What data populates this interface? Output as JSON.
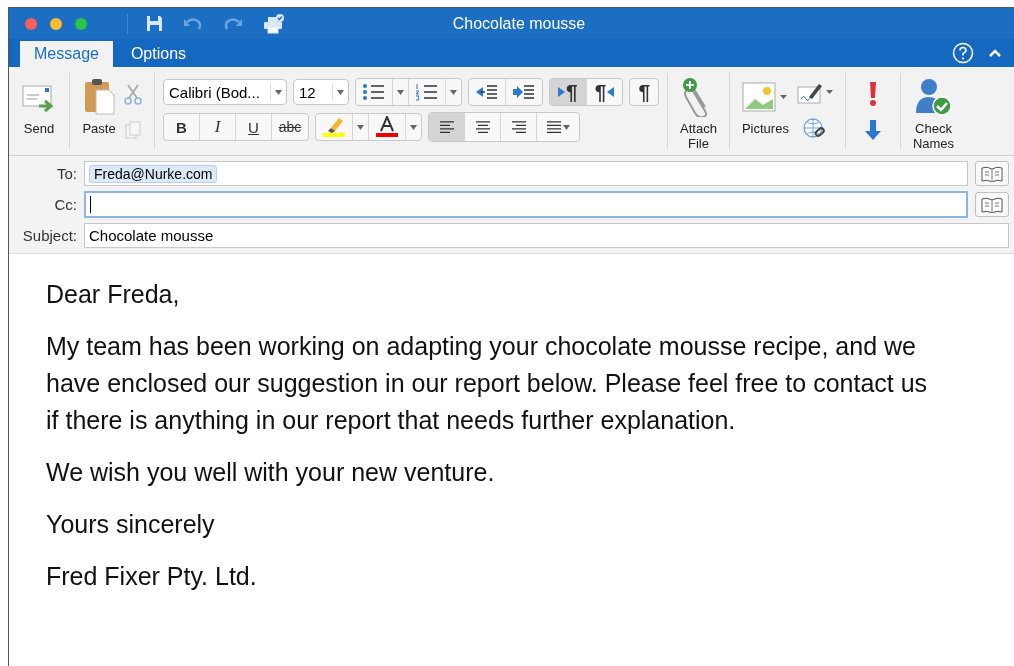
{
  "window": {
    "title": "Chocolate mousse"
  },
  "tabs": [
    {
      "label": "Message",
      "selected": true
    },
    {
      "label": "Options",
      "selected": false
    }
  ],
  "ribbon": {
    "send": "Send",
    "paste": "Paste",
    "font": {
      "name": "Calibri (Bod...",
      "size": "12"
    },
    "text_buttons": [
      {
        "kind": "bold",
        "label": "B",
        "pressed": false
      },
      {
        "kind": "italic",
        "label": "I",
        "pressed": false
      },
      {
        "kind": "underline",
        "label": "U",
        "pressed": false
      },
      {
        "kind": "strikethrough",
        "label": "abc",
        "pressed": false
      }
    ],
    "paragraph_buttons": [
      {
        "kind": "ltr",
        "label": "¶",
        "pressed": true
      },
      {
        "kind": "rtl",
        "label": "¶",
        "pressed": false
      }
    ],
    "marks_button": {
      "label": "¶",
      "pressed": false
    },
    "align_buttons": [
      {
        "kind": "left",
        "pressed": true
      },
      {
        "kind": "center",
        "pressed": false
      },
      {
        "kind": "right",
        "pressed": false
      },
      {
        "kind": "justify",
        "pressed": false
      }
    ],
    "attach": "Attach\nFile",
    "pictures": "Pictures",
    "check_names": "Check\nNames"
  },
  "header": {
    "to": {
      "label": "To:",
      "recipients": [
        "Freda@Nurke.com"
      ]
    },
    "cc": {
      "label": "Cc:",
      "focused": true
    },
    "subject": {
      "label": "Subject:",
      "value": "Chocolate mousse"
    }
  },
  "body": {
    "paragraphs": [
      "Dear Freda,",
      "My team has been working on adapting your chocolate mousse recipe, and we have enclosed our suggestion in our report below. Please feel free to contact us if there is anything in our report that needs further explanation.",
      "We wish you well with your new venture.",
      "Yours sincerely",
      "Fred Fixer Pty. Ltd."
    ]
  }
}
